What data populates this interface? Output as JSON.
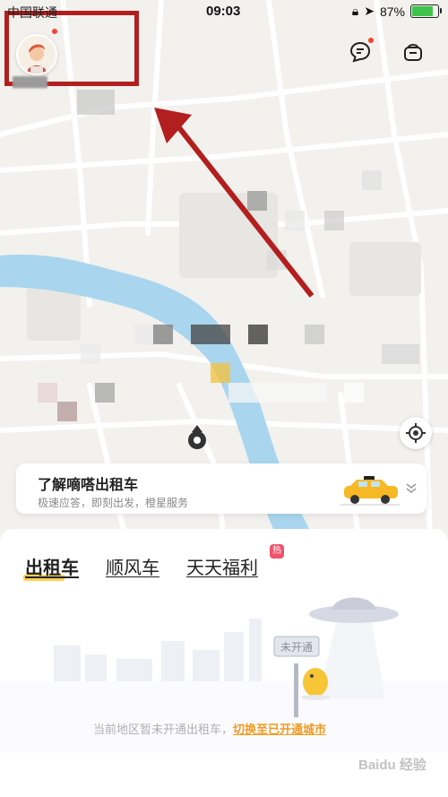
{
  "status_bar": {
    "carrier": "中国联通",
    "time": "09:03",
    "battery": "87%",
    "battery_level": 0.87
  },
  "header": {
    "avatar": "avatar-illustration",
    "message_icon": "chat-bubble-icon",
    "wallet_icon": "coin-box-icon"
  },
  "promo": {
    "title": "了解嘀嗒出租车",
    "subtitle": "极速应答，即刻出发，橙星服务"
  },
  "tabs": [
    {
      "label": "出租车",
      "active": true
    },
    {
      "label": "顺风车",
      "active": false
    },
    {
      "label": "天天福利",
      "active": false
    }
  ],
  "hot_badge": "热",
  "scene_sign": "未开通",
  "notice": {
    "text": "当前地区暂未开通出租车，",
    "link": "切换至已开通城市"
  },
  "colors": {
    "accent": "#ffd24c",
    "link": "#f29a1e",
    "annotation": "#b31e1e",
    "river": "#a9d6ee"
  },
  "watermark": "Baidu 经验"
}
